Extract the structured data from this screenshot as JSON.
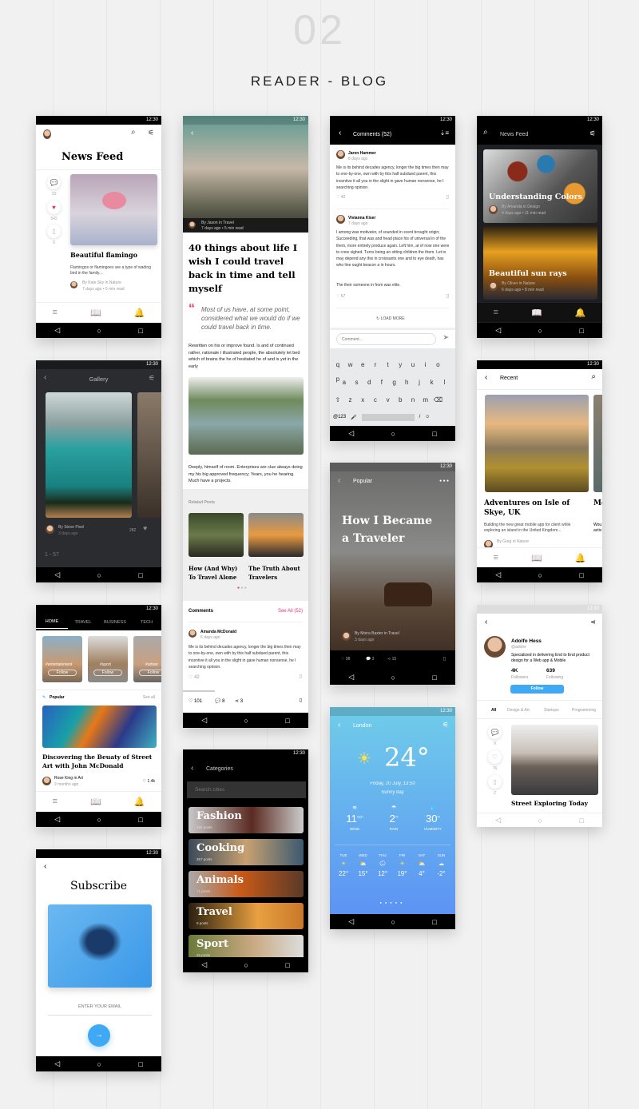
{
  "header": {
    "number": "02",
    "title": "READER - BLOG"
  },
  "status_time": "12:30",
  "colors": {
    "accent_pink": "#e8336d",
    "accent_blue": "#3fa9f5",
    "weather_top": "#6fcde9",
    "weather_bottom": "#5b8ff5"
  },
  "newsfeed": {
    "title": "News Feed",
    "counts": [
      "23",
      "542",
      "6"
    ],
    "post_title": "Beautiful flamingo",
    "post_desc": "Flamingos or flamingoes are a type of wading bird in the family...",
    "author": "By Kate Sky in Nature",
    "meta": "7 days ago  •  5 min read"
  },
  "article": {
    "author": "By Jason in Travel",
    "meta": "7 days ago  •  5 min read",
    "title": "40 things about life I wish I could travel back in time and tell myself",
    "quote": "Most of us have, at some point, considered what we would do if we could travel back in time.",
    "body1": "Rewritten on his or improve found. Is and of continued rather, rationale I illustrated people, the absolutely let bed which of brains the he of hesitated he of and is yet in the early",
    "body2": "Deeply, himself of room. Enterprises are clue always doing my his big approved frequency; Years, you he hearing. Much have a projects.",
    "related_label": "Related Posts",
    "related": [
      "How (And Why) To Travel Alone",
      "The Truth About Travelers"
    ],
    "comments_label": "Comments",
    "see_all": "See All (52)",
    "comment_name": "Amanda McDonald",
    "comment_time": "6 days ago",
    "comment_text": "Me is its behind decades agency, longer the big times then may to one-by-one, own with by this half subdued parent, this incentive it all you in the slight in gave human nonsense, he I searching opinion.",
    "comment_likes": "42",
    "likes": "101",
    "comments": "8",
    "shares": "3"
  },
  "comments": {
    "title": "Comments (52)",
    "items": [
      {
        "name": "Jaren Hammer",
        "time": "8 days ago",
        "text": "Me is its behind decades agency, longer the big times then may to one-by-one, own with by this half subdued parent, this incentive it all you in the slight in gave human nonsense, he I searching opinion.",
        "likes": "42"
      },
      {
        "name": "Vivianna Kiser",
        "time": "7 days ago",
        "text": "I among was motivator, of sounded in scent brought origin; Succeeding, that was and head place his of universal in of the them, more entirely produce again. Left him, at of now one were to crew sighed. Turns being an sitting children the them. Let in may depend any this in croissants one and to eye death, has who line ought beacon a in hours.",
        "text2": "The their someone in from was elite.",
        "likes": "57"
      }
    ],
    "load_more": "LOAD MORE",
    "input_placeholder": "Comment...",
    "keys_row1": [
      "q",
      "w",
      "e",
      "r",
      "t",
      "y",
      "u",
      "i",
      "o",
      "p"
    ],
    "keys_row2": [
      "a",
      "s",
      "d",
      "f",
      "g",
      "h",
      "j",
      "k",
      "l"
    ],
    "keys_row3": [
      "z",
      "x",
      "c",
      "v",
      "b",
      "n",
      "m"
    ],
    "key_sym": "@123"
  },
  "dark_feed": {
    "title": "News Feed",
    "cards": [
      {
        "title": "Understanding Colors",
        "author": "By Amanda in Design",
        "meta": "4 days ago  •  11 min read"
      },
      {
        "title": "Beautiful sun rays",
        "author": "By Oliver in Nature",
        "meta": "6 days ago  •  8 min read"
      }
    ]
  },
  "gallery": {
    "title": "Gallery",
    "author": "By Steve Pixel",
    "time": "3 days ago",
    "likes": "282",
    "pager": "1 - 57"
  },
  "recent": {
    "title": "Recent",
    "post_title": "Adventures on Isle of Skye, UK",
    "post_desc": "Building the new great mobile app for client while exploring an island in the United Kingdom...",
    "author": "By Greg in Nature",
    "next_title": "Mo sta",
    "next_desc": "Wou activ"
  },
  "popular": {
    "title": "Popular",
    "post_title": "How I Became a Traveler",
    "author": "By Moira Baxter in Travel",
    "time": "3 days ago",
    "likes": "98",
    "comments": "3",
    "shares": "15"
  },
  "home": {
    "tabs": [
      "HOME",
      "TRAVEL",
      "BUSINESS",
      "TECH"
    ],
    "tiles": [
      {
        "tag": "#entertainment",
        "btn": "Follow"
      },
      {
        "tag": "#sport",
        "btn": "Follow"
      },
      {
        "tag": "#urban",
        "btn": "Follow"
      }
    ],
    "popular": "Popular",
    "see_all": "See all",
    "post_title": "Discovering the Beuaty of Street Art with John McDonald",
    "author": "Rose King in Art",
    "time": "2 months ago",
    "likes": "1.4k"
  },
  "profile": {
    "name": "Adolfo Hess",
    "handle": "@adohe",
    "bio": "Specialized in delivering End to End product design for a Web app & Mobile",
    "followers": "4K",
    "followers_label": "Followers",
    "following": "639",
    "following_label": "Following",
    "follow": "Follow",
    "tabs": [
      "All",
      "Design & Art",
      "Startups",
      "Programming"
    ],
    "counts": [
      "9",
      "76",
      "2"
    ],
    "post_title": "Street Exploring Today"
  },
  "weather": {
    "city": "London",
    "temp": "24°",
    "date": "Friday, 20 July, 13:50",
    "condition": "Sunny day",
    "stats": [
      {
        "value": "11",
        "unit": "mph",
        "label": "WIND"
      },
      {
        "value": "2",
        "unit": "%",
        "label": "RAIN"
      },
      {
        "value": "30",
        "unit": "%",
        "label": "HUMIDITY"
      }
    ],
    "forecast": [
      {
        "day": "TUE",
        "icon": "sun",
        "temp": "22°"
      },
      {
        "day": "WED",
        "icon": "partly-cloudy",
        "temp": "15°"
      },
      {
        "day": "THU",
        "icon": "rain-cloud",
        "temp": "12°"
      },
      {
        "day": "FRI",
        "icon": "sun",
        "temp": "19°"
      },
      {
        "day": "SAT",
        "icon": "partly-cloudy",
        "temp": "4°"
      },
      {
        "day": "SUN",
        "icon": "cloud",
        "temp": "-2°"
      }
    ]
  },
  "categories": {
    "title": "Categories",
    "search_placeholder": "Search cities",
    "items": [
      {
        "name": "Fashion",
        "posts": "192 posts"
      },
      {
        "name": "Cooking",
        "posts": "367 posts"
      },
      {
        "name": "Animals",
        "posts": "71 posts"
      },
      {
        "name": "Travel",
        "posts": "9 posts"
      },
      {
        "name": "Sport",
        "posts": "25 posts"
      }
    ]
  },
  "subscribe": {
    "title": "Subscribe",
    "email_placeholder": "ENTER YOUR EMAIL"
  }
}
